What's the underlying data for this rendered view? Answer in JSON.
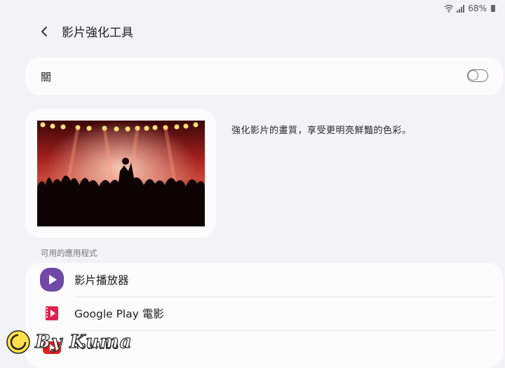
{
  "status_bar": {
    "battery": "68%"
  },
  "header": {
    "title": "影片強化工具"
  },
  "toggle": {
    "label": "關",
    "enabled": false
  },
  "preview": {
    "description": "強化影片的畫質，享受更明亮鮮豔的色彩。"
  },
  "apps_section": {
    "label": "可用的應用程式",
    "items": [
      {
        "label": "影片播放器",
        "icon": "video-player-icon",
        "color": "#6f48a8"
      },
      {
        "label": "Google Play 電影",
        "icon": "google-play-movies-icon",
        "color": "#e0204e"
      },
      {
        "label": "YouTube",
        "icon": "youtube-icon",
        "color": "#e02020"
      }
    ]
  },
  "watermark": {
    "text": "By Kuma"
  }
}
